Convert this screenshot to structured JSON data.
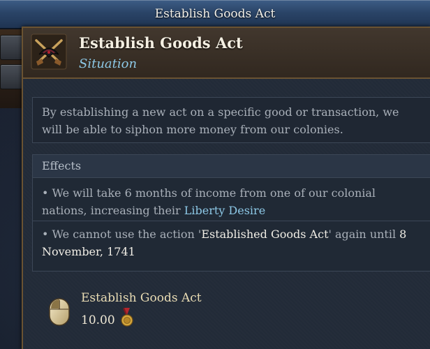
{
  "topbar": {
    "title": "Establish Goods Act"
  },
  "tooltip": {
    "title": "Establish Goods Act",
    "subtitle": "Situation",
    "icon": "crossed-pistols-hat-icon",
    "description": "By establishing a new act on a specific good or transaction, we will be able to siphon more money from our colonies.",
    "effects_label": "Effects",
    "effects": [
      {
        "prefix": "• We will take 6 months of income from one of our colonial nations, increasing their ",
        "highlight": "Liberty Desire"
      },
      {
        "prefix": "• We cannot use the action '",
        "highlight": "Established Goods Act",
        "middle": "' again until ",
        "date": "8 November, 1741"
      }
    ],
    "cost": {
      "icon": "mouse-icon",
      "name": "Establish Goods Act",
      "value": "10.00",
      "value_icon": "medal-icon"
    }
  },
  "colors": {
    "title_bar": "#2a4467",
    "frame_gold": "#6a5332",
    "highlight_blue": "#8dc8e6",
    "text_gray": "#a9b0b9"
  }
}
